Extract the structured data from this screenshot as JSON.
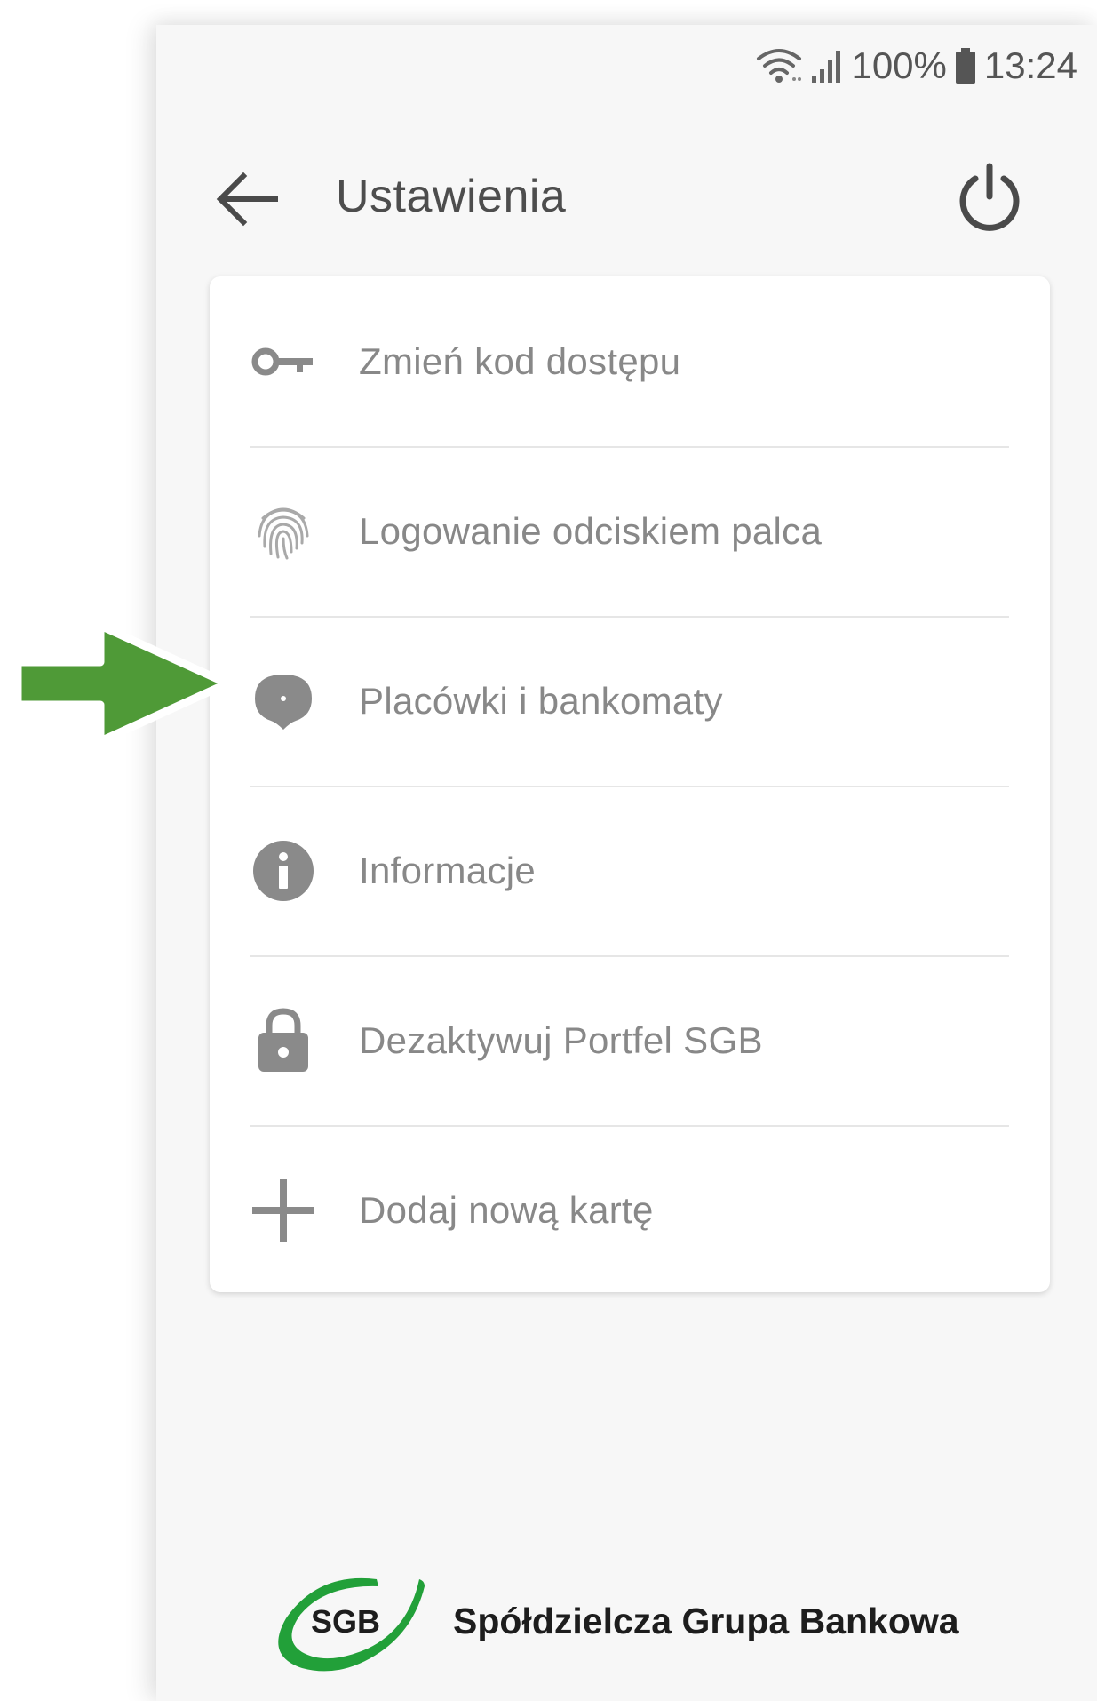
{
  "status_bar": {
    "battery": "100%",
    "time": "13:24"
  },
  "header": {
    "title": "Ustawienia"
  },
  "menu": {
    "items": [
      {
        "label": "Zmień kod dostępu",
        "icon": "key-icon"
      },
      {
        "label": "Logowanie odciskiem palca",
        "icon": "fingerprint-icon"
      },
      {
        "label": "Placówki i bankomaty",
        "icon": "location-pin-icon"
      },
      {
        "label": "Informacje",
        "icon": "info-icon"
      },
      {
        "label": "Dezaktywuj Portfel SGB",
        "icon": "lock-icon"
      },
      {
        "label": "Dodaj nową kartę",
        "icon": "plus-icon"
      }
    ]
  },
  "footer": {
    "logo_text": "SGB",
    "brand_name": "Spółdzielcza Grupa Bankowa"
  },
  "colors": {
    "icon_gray": "#8a8a8a",
    "logo_green": "#22a039",
    "annotation_arrow": "#4f9a37"
  }
}
